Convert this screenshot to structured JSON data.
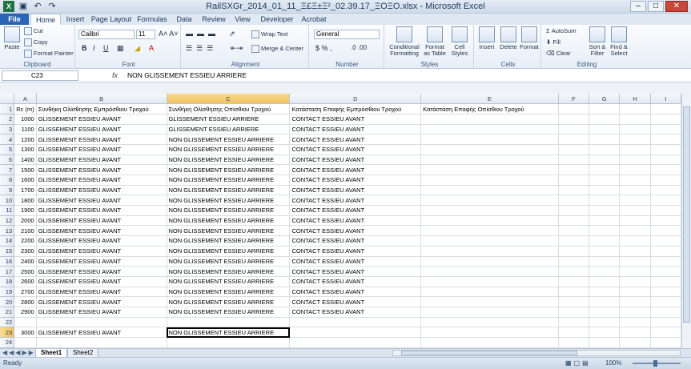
{
  "title": "RailSXGr_2014_01_11_Ξ£Ξ±Ξ²_02.39.17_ΞΟΞΟ.xlsx - Microsoft Excel",
  "tabs": [
    "File",
    "Home",
    "Insert",
    "Page Layout",
    "Formulas",
    "Data",
    "Review",
    "View",
    "Developer",
    "Acrobat"
  ],
  "ribbon": {
    "clipboard": {
      "paste": "Paste",
      "cut": "Cut",
      "copy": "Copy",
      "format_painter": "Format Painter",
      "label": "Clipboard"
    },
    "font": {
      "name": "Calibri",
      "size": "11",
      "label": "Font",
      "bold": "B",
      "italic": "I",
      "underline": "U"
    },
    "alignment": {
      "wrap": "Wrap Text",
      "merge": "Merge & Center",
      "label": "Alignment"
    },
    "number": {
      "format": "General",
      "label": "Number"
    },
    "styles": {
      "conditional": "Conditional Formatting",
      "format_table": "Format as Table",
      "cell_styles": "Cell Styles",
      "label": "Styles"
    },
    "cells": {
      "insert": "Insert",
      "delete": "Delete",
      "format": "Format",
      "label": "Cells"
    },
    "editing": {
      "autosum": "AutoSum",
      "fill": "Fill",
      "clear": "Clear",
      "sort": "Sort & Filter",
      "find": "Find & Select",
      "label": "Editing"
    }
  },
  "formula_bar": {
    "name_box": "C23",
    "fx": "fx",
    "value": "NON GLISSEMENT ESSIEU ARRIERE"
  },
  "columns": [
    "A",
    "B",
    "C",
    "D",
    "E",
    "F",
    "G",
    "H",
    "I"
  ],
  "selected_column": "C",
  "selected_row": "23",
  "header_row": {
    "row": "1",
    "a": "Rc (m)",
    "b": "Συνθήκη Ολίσθησης Εμπρόσθιου Τροχού",
    "c": "Συνθήκη Ολίσθησης Οπίσθιου Τροχού",
    "d": "Κατάσταση Επαφής Εμπρόσθιου Τροχού",
    "e": "Κατάσταση Επαφής Οπίσθιου Τροχού"
  },
  "rows": [
    {
      "row": "2",
      "a": "1000",
      "b": "GLISSEMENT ESSIEU AVANT",
      "c": "GLISSEMENT ESSIEU ARRIERE",
      "d": "CONTACT ESSIEU AVANT"
    },
    {
      "row": "3",
      "a": "1100",
      "b": "GLISSEMENT ESSIEU AVANT",
      "c": "GLISSEMENT ESSIEU ARRIERE",
      "d": "CONTACT ESSIEU AVANT"
    },
    {
      "row": "4",
      "a": "1200",
      "b": "GLISSEMENT ESSIEU AVANT",
      "c": "NON GLISSEMENT ESSIEU ARRIERE",
      "d": "CONTACT ESSIEU AVANT"
    },
    {
      "row": "5",
      "a": "1300",
      "b": "GLISSEMENT ESSIEU AVANT",
      "c": "NON GLISSEMENT ESSIEU ARRIERE",
      "d": "CONTACT ESSIEU AVANT"
    },
    {
      "row": "6",
      "a": "1400",
      "b": "GLISSEMENT ESSIEU AVANT",
      "c": "NON GLISSEMENT ESSIEU ARRIERE",
      "d": "CONTACT ESSIEU AVANT"
    },
    {
      "row": "7",
      "a": "1500",
      "b": "GLISSEMENT ESSIEU AVANT",
      "c": "NON GLISSEMENT ESSIEU ARRIERE",
      "d": "CONTACT ESSIEU AVANT"
    },
    {
      "row": "8",
      "a": "1600",
      "b": "GLISSEMENT ESSIEU AVANT",
      "c": "NON GLISSEMENT ESSIEU ARRIERE",
      "d": "CONTACT ESSIEU AVANT"
    },
    {
      "row": "9",
      "a": "1700",
      "b": "GLISSEMENT ESSIEU AVANT",
      "c": "NON GLISSEMENT ESSIEU ARRIERE",
      "d": "CONTACT ESSIEU AVANT"
    },
    {
      "row": "10",
      "a": "1800",
      "b": "GLISSEMENT ESSIEU AVANT",
      "c": "NON GLISSEMENT ESSIEU ARRIERE",
      "d": "CONTACT ESSIEU AVANT"
    },
    {
      "row": "11",
      "a": "1900",
      "b": "GLISSEMENT ESSIEU AVANT",
      "c": "NON GLISSEMENT ESSIEU ARRIERE",
      "d": "CONTACT ESSIEU AVANT"
    },
    {
      "row": "12",
      "a": "2000",
      "b": "GLISSEMENT ESSIEU AVANT",
      "c": "NON GLISSEMENT ESSIEU ARRIERE",
      "d": "CONTACT ESSIEU AVANT"
    },
    {
      "row": "13",
      "a": "2100",
      "b": "GLISSEMENT ESSIEU AVANT",
      "c": "NON GLISSEMENT ESSIEU ARRIERE",
      "d": "CONTACT ESSIEU AVANT"
    },
    {
      "row": "14",
      "a": "2200",
      "b": "GLISSEMENT ESSIEU AVANT",
      "c": "NON GLISSEMENT ESSIEU ARRIERE",
      "d": "CONTACT ESSIEU AVANT"
    },
    {
      "row": "15",
      "a": "2300",
      "b": "GLISSEMENT ESSIEU AVANT",
      "c": "NON GLISSEMENT ESSIEU ARRIERE",
      "d": "CONTACT ESSIEU AVANT"
    },
    {
      "row": "16",
      "a": "2400",
      "b": "GLISSEMENT ESSIEU AVANT",
      "c": "NON GLISSEMENT ESSIEU ARRIERE",
      "d": "CONTACT ESSIEU AVANT"
    },
    {
      "row": "17",
      "a": "2500",
      "b": "GLISSEMENT ESSIEU AVANT",
      "c": "NON GLISSEMENT ESSIEU ARRIERE",
      "d": "CONTACT ESSIEU AVANT"
    },
    {
      "row": "18",
      "a": "2600",
      "b": "GLISSEMENT ESSIEU AVANT",
      "c": "NON GLISSEMENT ESSIEU ARRIERE",
      "d": "CONTACT ESSIEU AVANT"
    },
    {
      "row": "19",
      "a": "2700",
      "b": "GLISSEMENT ESSIEU AVANT",
      "c": "NON GLISSEMENT ESSIEU ARRIERE",
      "d": "CONTACT ESSIEU AVANT"
    },
    {
      "row": "20",
      "a": "2800",
      "b": "GLISSEMENT ESSIEU AVANT",
      "c": "NON GLISSEMENT ESSIEU ARRIERE",
      "d": "CONTACT ESSIEU AVANT"
    },
    {
      "row": "21",
      "a": "2900",
      "b": "GLISSEMENT ESSIEU AVANT",
      "c": "NON GLISSEMENT ESSIEU ARRIERE",
      "d": "CONTACT ESSIEU AVANT"
    },
    {
      "row": "22",
      "a": "",
      "b": "",
      "c": "",
      "d": ""
    },
    {
      "row": "23",
      "a": "3000",
      "b": "GLISSEMENT ESSIEU AVANT",
      "c": "NON GLISSEMENT ESSIEU ARRIERE",
      "d": ""
    },
    {
      "row": "24",
      "a": "",
      "b": "",
      "c": "",
      "d": ""
    }
  ],
  "sheet_tabs": [
    "Sheet1",
    "Sheet2"
  ],
  "status": {
    "ready": "Ready",
    "zoom": "100%"
  }
}
